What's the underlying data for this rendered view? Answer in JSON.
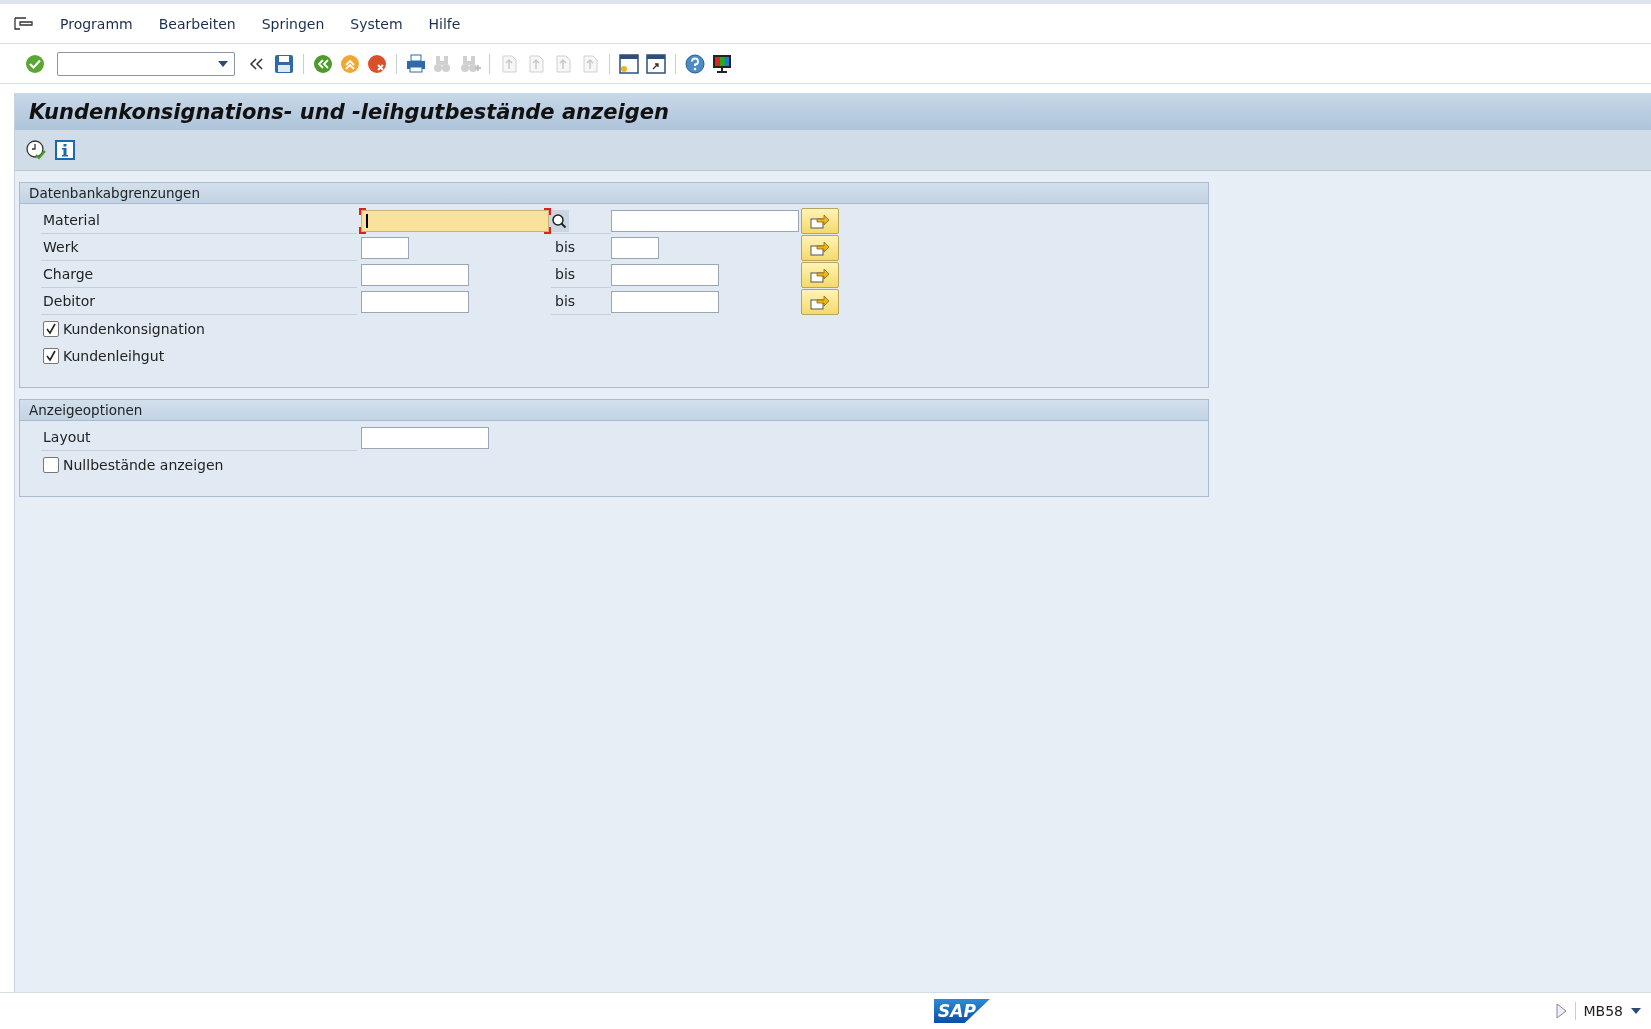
{
  "menu": [
    {
      "label": "Programm"
    },
    {
      "label": "Bearbeiten"
    },
    {
      "label": "Springen"
    },
    {
      "label": "System"
    },
    {
      "label": "Hilfe"
    }
  ],
  "toolbar": [
    {
      "kind": "enter",
      "disabled": false
    },
    {
      "kind": "command"
    },
    {
      "kind": "collapse",
      "disabled": false
    },
    {
      "kind": "save",
      "disabled": false
    },
    {
      "kind": "sep"
    },
    {
      "kind": "back",
      "disabled": false
    },
    {
      "kind": "exit",
      "disabled": false
    },
    {
      "kind": "cancel",
      "disabled": false
    },
    {
      "kind": "sep"
    },
    {
      "kind": "print",
      "disabled": false
    },
    {
      "kind": "find",
      "disabled": true
    },
    {
      "kind": "findnext",
      "disabled": true
    },
    {
      "kind": "sep"
    },
    {
      "kind": "first",
      "disabled": true
    },
    {
      "kind": "prev",
      "disabled": true
    },
    {
      "kind": "next",
      "disabled": true
    },
    {
      "kind": "last",
      "disabled": true
    },
    {
      "kind": "sep"
    },
    {
      "kind": "newsession",
      "disabled": false
    },
    {
      "kind": "shortcut",
      "disabled": false
    },
    {
      "kind": "sep"
    },
    {
      "kind": "help",
      "disabled": false
    },
    {
      "kind": "layout",
      "disabled": false
    }
  ],
  "title": "Kundenkonsignations- und -leihgutbestände anzeigen",
  "app_toolbar": [
    {
      "kind": "execute"
    },
    {
      "kind": "info"
    }
  ],
  "groups": [
    {
      "title": "Datenbankabgrenzungen",
      "rows": [
        {
          "kind": "range",
          "label": "Material",
          "from_focused": true
        },
        {
          "kind": "range",
          "label": "Werk",
          "from_focused": false,
          "to_label": "bis"
        },
        {
          "kind": "range",
          "label": "Charge",
          "from_focused": false,
          "to_label": "bis"
        },
        {
          "kind": "range",
          "label": "Debitor",
          "from_focused": false,
          "to_label": "bis"
        },
        {
          "kind": "checkbox",
          "label": "Kundenkonsignation",
          "checked": true
        },
        {
          "kind": "checkbox",
          "label": "Kundenleihgut",
          "checked": true
        }
      ]
    },
    {
      "title": "Anzeigeoptionen",
      "rows": [
        {
          "kind": "field",
          "label": "Layout",
          "from_focused": false
        },
        {
          "kind": "checkbox",
          "label": "Nullbestände anzeigen",
          "checked": false
        }
      ]
    }
  ],
  "status_bar": {
    "logo": "SAP",
    "transaction": "MB58"
  }
}
